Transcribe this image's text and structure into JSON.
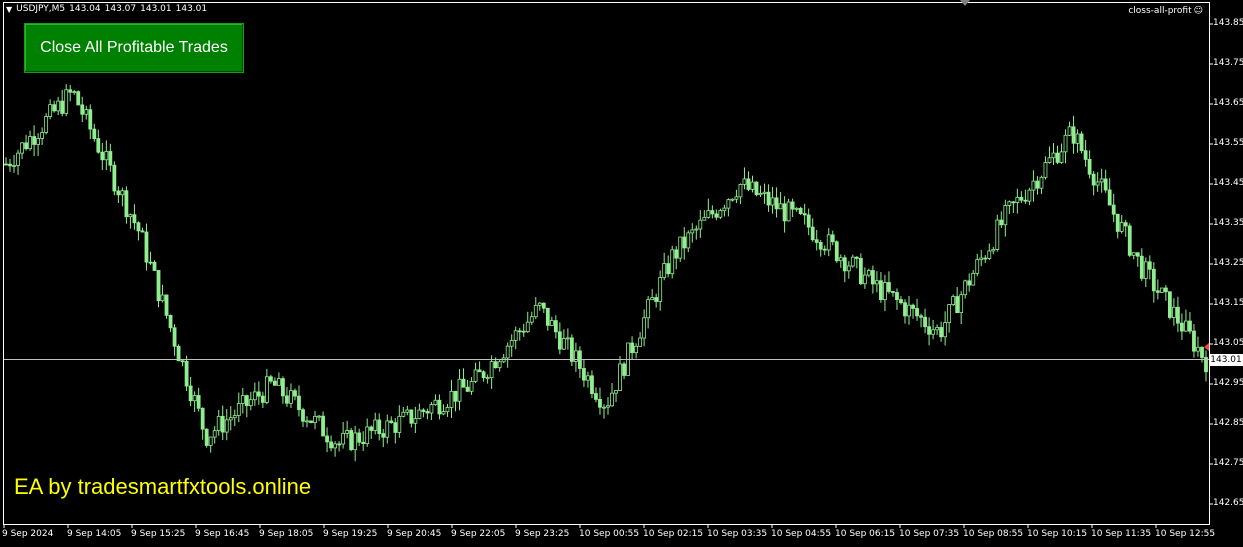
{
  "header": {
    "symbol": "USDJPY,M5",
    "open": "143.04",
    "high": "143.07",
    "low": "143.01",
    "close": "143.01",
    "ea_name": "closs-all-profit",
    "ea_icon": "smiley-icon"
  },
  "button": {
    "label": "Close All Profitable Trades",
    "color": "#008000"
  },
  "watermark": {
    "text": "EA by tradesmartfxtools.online",
    "color": "#ffff00"
  },
  "price_axis": {
    "labels": [
      "143.85",
      "143.75",
      "143.65",
      "143.55",
      "143.45",
      "143.35",
      "143.25",
      "143.15",
      "143.05",
      "142.95",
      "142.85",
      "142.75",
      "142.65"
    ],
    "current_price": "143.01"
  },
  "time_axis": {
    "labels": [
      "9 Sep 2024",
      "9 Sep 14:05",
      "9 Sep 15:25",
      "9 Sep 16:45",
      "9 Sep 18:05",
      "9 Sep 19:25",
      "9 Sep 20:45",
      "9 Sep 22:05",
      "9 Sep 23:25",
      "10 Sep 00:55",
      "10 Sep 02:15",
      "10 Sep 03:35",
      "10 Sep 04:55",
      "10 Sep 06:15",
      "10 Sep 07:35",
      "10 Sep 08:55",
      "10 Sep 10:15",
      "10 Sep 11:35",
      "10 Sep 12:55"
    ]
  },
  "colors": {
    "candle": "#90ee90",
    "background": "#000000",
    "axis": "#ffffff",
    "current_price_line": "#c0c0c0"
  },
  "chart_data": {
    "type": "line",
    "title": "USDJPY,M5",
    "xlabel": "",
    "ylabel": "",
    "ylim": [
      142.62,
      143.88
    ],
    "grid": false,
    "series": [
      {
        "name": "USDJPY",
        "x": [
          "9 Sep 2024",
          "9 Sep 14:05",
          "9 Sep 15:25",
          "9 Sep 16:45",
          "9 Sep 18:05",
          "9 Sep 19:25",
          "9 Sep 20:45",
          "9 Sep 22:05",
          "9 Sep 23:25",
          "10 Sep 00:55",
          "10 Sep 02:15",
          "10 Sep 03:35",
          "10 Sep 04:55",
          "10 Sep 06:15",
          "10 Sep 07:35",
          "10 Sep 08:55",
          "10 Sep 10:15",
          "10 Sep 11:35",
          "10 Sep 12:55"
        ],
        "values": [
          143.5,
          143.68,
          143.33,
          142.82,
          142.95,
          142.8,
          142.86,
          142.95,
          143.14,
          142.9,
          143.27,
          143.45,
          143.35,
          143.2,
          143.08,
          143.37,
          143.58,
          143.25,
          143.01
        ]
      }
    ]
  }
}
